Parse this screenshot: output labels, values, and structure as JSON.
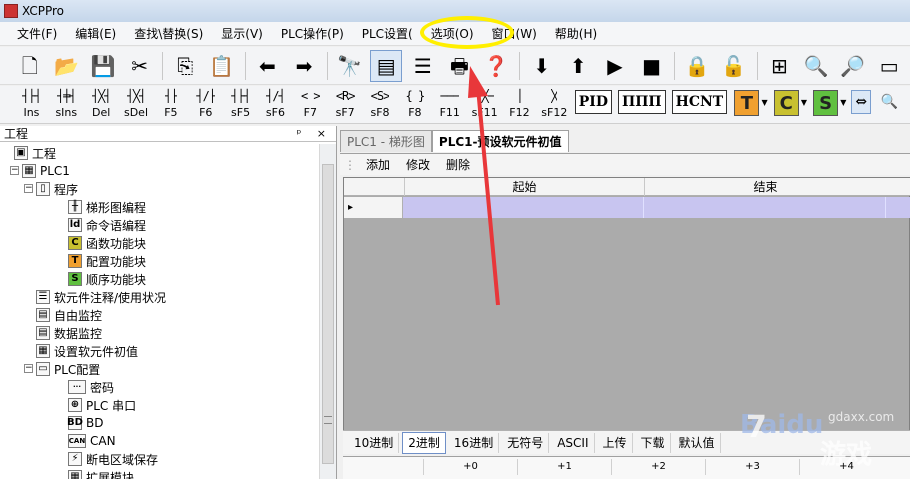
{
  "window": {
    "title": "XCPPro"
  },
  "menu": [
    "文件(F)",
    "编辑(E)",
    "查找\\替换(S)",
    "显示(V)",
    "PLC操作(P)",
    "PLC设置(",
    "选项(O)",
    "窗口(W)",
    "帮助(H)"
  ],
  "toolbar1": [
    {
      "icon": "new-file-icon",
      "glyph": "🗋"
    },
    {
      "icon": "open-folder-icon",
      "glyph": "📂"
    },
    {
      "icon": "save-icon",
      "glyph": "💾"
    },
    {
      "icon": "cut-icon",
      "glyph": "✂"
    },
    {
      "icon": "copy-icon",
      "glyph": "⎘"
    },
    {
      "icon": "paste-icon",
      "glyph": "📋"
    },
    {
      "icon": "arrow-left-icon",
      "glyph": "⬅"
    },
    {
      "icon": "arrow-right-icon",
      "glyph": "➡"
    },
    {
      "icon": "binoculars-icon",
      "glyph": "🔭"
    },
    {
      "icon": "ladder-view-icon",
      "glyph": "▤"
    },
    {
      "icon": "instruction-list-icon",
      "glyph": "☰"
    },
    {
      "icon": "print-icon",
      "glyph": "🖶"
    },
    {
      "icon": "help-icon",
      "glyph": "❓"
    },
    {
      "icon": "download-arrow-icon",
      "glyph": "⬇"
    },
    {
      "icon": "upload-arrow-icon",
      "glyph": "⬆"
    },
    {
      "icon": "run-icon",
      "glyph": "▶"
    },
    {
      "icon": "stop-icon",
      "glyph": "■"
    },
    {
      "icon": "lock-icon",
      "glyph": "🔒"
    },
    {
      "icon": "unlock-icon",
      "glyph": "🔓"
    },
    {
      "icon": "network-icon",
      "glyph": "⊞"
    },
    {
      "icon": "monitor-zoom-icon",
      "glyph": "🔍"
    },
    {
      "icon": "document-zoom-icon",
      "glyph": "🔎"
    },
    {
      "icon": "serial-port-icon",
      "glyph": "▭"
    }
  ],
  "toolbar2": [
    {
      "glyph": "┤├┤",
      "label": "Ins"
    },
    {
      "glyph": "┤╪┤",
      "label": "sIns"
    },
    {
      "glyph": "┤╳┤",
      "label": "Del"
    },
    {
      "glyph": "┤╳┤",
      "label": "sDel"
    },
    {
      "glyph": "┤├",
      "label": "F5"
    },
    {
      "glyph": "┤/├",
      "label": "F6"
    },
    {
      "glyph": "┤├┤",
      "label": "sF5"
    },
    {
      "glyph": "┤/┤",
      "label": "sF6"
    },
    {
      "glyph": "<  >",
      "label": "F7"
    },
    {
      "glyph": "<R>",
      "label": "sF7"
    },
    {
      "glyph": "<S>",
      "label": "sF8"
    },
    {
      "glyph": "{  }",
      "label": "F8"
    },
    {
      "glyph": "───",
      "label": "F11"
    },
    {
      "glyph": "─╳─",
      "label": "sF11"
    },
    {
      "glyph": "│",
      "label": "F12"
    },
    {
      "glyph": "╳",
      "label": "sF12"
    }
  ],
  "toolbar2_blocks": [
    "PID",
    "ΠΠΠ",
    "HCNT"
  ],
  "toolbar2_colors": [
    {
      "letter": "T",
      "color": "#f0a030"
    },
    {
      "letter": "C",
      "color": "#c8c030"
    },
    {
      "letter": "S",
      "color": "#60c040"
    }
  ],
  "left_pane": {
    "title": "工程",
    "controls": "ᵖ ×",
    "tree": [
      {
        "label": "工程",
        "icon": "project-icon",
        "iconchar": "▣",
        "depth": 0
      },
      {
        "label": "PLC1",
        "icon": "plc-icon",
        "iconchar": "▦",
        "depth": 1
      },
      {
        "label": "程序",
        "icon": "program-icon",
        "iconchar": "▯",
        "depth": 2
      },
      {
        "label": "梯形图编程",
        "icon": "ladder-icon",
        "iconchar": "╫",
        "depth": 3
      },
      {
        "label": "命令语编程",
        "icon": "command-icon",
        "iconchar": "ld",
        "depth": 3
      },
      {
        "label": "函数功能块",
        "icon": "function-block-icon",
        "iconchar": "C",
        "depth": 3
      },
      {
        "label": "配置功能块",
        "icon": "config-block-icon",
        "iconchar": "T",
        "depth": 3
      },
      {
        "label": "顺序功能块",
        "icon": "sequence-block-icon",
        "iconchar": "S",
        "depth": 3
      },
      {
        "label": "软元件注释/使用状况",
        "icon": "comment-icon",
        "iconchar": "☰",
        "depth": 2
      },
      {
        "label": "自由监控",
        "icon": "free-monitor-icon",
        "iconchar": "▤",
        "depth": 2
      },
      {
        "label": "数据监控",
        "icon": "data-monitor-icon",
        "iconchar": "▤",
        "depth": 2
      },
      {
        "label": "设置软元件初值",
        "icon": "init-value-icon",
        "iconchar": "▦",
        "depth": 2
      },
      {
        "label": "PLC配置",
        "icon": "folder-icon",
        "iconchar": "▭",
        "depth": 2
      },
      {
        "label": "密码",
        "icon": "password-icon",
        "iconchar": "···",
        "depth": 3
      },
      {
        "label": "PLC 串口",
        "icon": "serial-icon",
        "iconchar": "⊕",
        "depth": 3
      },
      {
        "label": "BD",
        "icon": "bd-icon",
        "iconchar": "BD",
        "depth": 3
      },
      {
        "label": "CAN",
        "icon": "can-icon",
        "iconchar": "CAN",
        "depth": 3
      },
      {
        "label": "断电区域保存",
        "icon": "power-save-icon",
        "iconchar": "⚡",
        "depth": 3
      },
      {
        "label": "扩展模块",
        "icon": "expansion-icon",
        "iconchar": "▦",
        "depth": 3
      }
    ]
  },
  "tabs": [
    {
      "label": "PLC1 - 梯形图",
      "active": false
    },
    {
      "label": "PLC1-预设软元件初值",
      "active": true
    }
  ],
  "subtoolbar": [
    "添加",
    "修改",
    "删除"
  ],
  "grid": {
    "columns": [
      "起始",
      "结束"
    ],
    "row_marker": "▸"
  },
  "bottom_toolbar": [
    "10进制",
    "2进制",
    "16进制",
    "无符号",
    "ASCII",
    "上传",
    "下载",
    "默认值"
  ],
  "bottom_grid": [
    "+0",
    "+1",
    "+2",
    "+3",
    "+4"
  ],
  "watermark": {
    "text1": "Baidu",
    "seven": "7",
    "site": "gdaxx.com",
    "game": "游戏"
  }
}
